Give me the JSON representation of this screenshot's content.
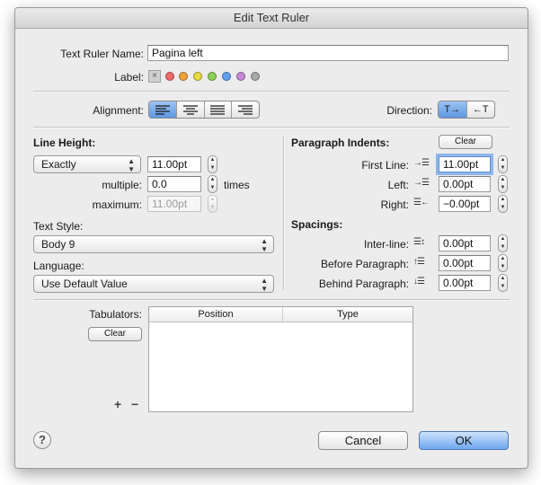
{
  "window": {
    "title": "Edit Text Ruler"
  },
  "header": {
    "name_label": "Text Ruler Name:",
    "name_value": "Pagina left",
    "label_label": "Label:",
    "label_clear_icon": "×",
    "label_colors": [
      "#f06a6a",
      "#f2a23a",
      "#eadb3a",
      "#8bd15a",
      "#5fa0ef",
      "#c48ad8",
      "#a8a8a8"
    ]
  },
  "alignment": {
    "label": "Alignment:",
    "options": [
      "align-left-icon",
      "align-center-icon",
      "align-justify-icon",
      "align-right-icon"
    ],
    "selected": 0
  },
  "direction": {
    "label": "Direction:",
    "options": [
      {
        "icon": "left-to-right-icon",
        "glyph": "T→"
      },
      {
        "icon": "right-to-left-icon",
        "glyph": "←T"
      }
    ],
    "selected": 0
  },
  "line_height": {
    "section_label": "Line Height:",
    "mode": "Exactly",
    "value": "11.00pt",
    "multiple_label": "multiple:",
    "multiple_value": "0.0",
    "times_label": "times",
    "maximum_label": "maximum:",
    "maximum_value": "11.00pt"
  },
  "text_style": {
    "label": "Text Style:",
    "value": "Body 9"
  },
  "language": {
    "label": "Language:",
    "value": "Use Default Value"
  },
  "indents": {
    "section_label": "Paragraph Indents:",
    "clear_label": "Clear",
    "first_line_label": "First Line:",
    "first_line_value": "11.00pt",
    "left_label": "Left:",
    "left_value": "0.00pt",
    "right_label": "Right:",
    "right_value": "−0.00pt"
  },
  "spacings": {
    "section_label": "Spacings:",
    "inter_line_label": "Inter-line:",
    "inter_line_value": "0.00pt",
    "before_label": "Before Paragraph:",
    "before_value": "0.00pt",
    "behind_label": "Behind Paragraph:",
    "behind_value": "0.00pt"
  },
  "tabulators": {
    "label": "Tabulators:",
    "clear_label": "Clear",
    "columns": [
      "Position",
      "Type"
    ],
    "add_label": "+",
    "remove_label": "−"
  },
  "footer": {
    "help_label": "?",
    "cancel_label": "Cancel",
    "ok_label": "OK"
  }
}
